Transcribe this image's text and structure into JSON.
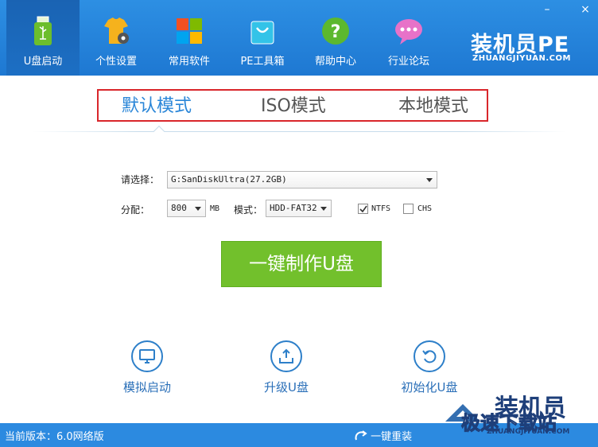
{
  "header": {
    "nav": [
      {
        "label": "U盘启动",
        "icon": "usb-drive-icon",
        "active": true
      },
      {
        "label": "个性设置",
        "icon": "tshirt-gear-icon",
        "active": false
      },
      {
        "label": "常用软件",
        "icon": "windows-tiles-icon",
        "active": false
      },
      {
        "label": "PE工具箱",
        "icon": "shopping-bag-icon",
        "active": false
      },
      {
        "label": "帮助中心",
        "icon": "help-question-icon",
        "active": false
      },
      {
        "label": "行业论坛",
        "icon": "chat-bubble-icon",
        "active": false
      }
    ],
    "brand": "装机员PE",
    "brand_sub": "ZHUANGJIYUAN.COM",
    "window_controls": {
      "minimize": "–",
      "close": "×"
    }
  },
  "modes": {
    "items": [
      "默认模式",
      "ISO模式",
      "本地模式"
    ],
    "active_index": 0
  },
  "form": {
    "select_label": "请选择：",
    "device": "G:SanDiskUltra(27.2GB)",
    "alloc_label": "分配：",
    "alloc_value": "800",
    "alloc_unit": "MB",
    "mode_label": "模式：",
    "mode_value": "HDD-FAT32",
    "ntfs_label": "NTFS",
    "ntfs_checked": true,
    "chs_label": "CHS",
    "chs_checked": false
  },
  "primary_button": "一键制作U盘",
  "actions": [
    {
      "label": "模拟启动",
      "icon": "monitor-icon"
    },
    {
      "label": "升级U盘",
      "icon": "upload-tray-icon"
    },
    {
      "label": "初始化U盘",
      "icon": "refresh-icon"
    }
  ],
  "status": {
    "version": "当前版本：6.0网络版",
    "reinstall": "一键重装"
  },
  "watermark": {
    "title": "装机员",
    "overlay": "极速下载站",
    "url": "ZHUANGJIYUAN.COM"
  },
  "colors": {
    "header_blue": "#2d8fe3",
    "active_tab": "#2a86d8",
    "highlight_box": "#d9262b",
    "green_button": "#72c02c",
    "status_bar": "#2c8ae0"
  }
}
